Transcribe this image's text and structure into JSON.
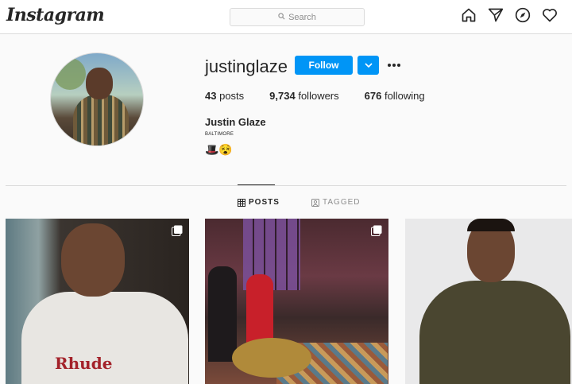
{
  "app": {
    "logo": "Instagram"
  },
  "search": {
    "placeholder": "Search"
  },
  "nav": {
    "icons": [
      "home-icon",
      "direct-icon",
      "explore-icon",
      "activity-heart-icon"
    ]
  },
  "profile": {
    "username": "justinglaze",
    "follow_label": "Follow",
    "posts_count": "43",
    "posts_label": "posts",
    "followers_count": "9,734",
    "followers_label": "followers",
    "following_count": "676",
    "following_label": "following",
    "full_name": "Justin Glaze",
    "bio_line": "BALTIMORE",
    "bio_emoji": "🎩😵"
  },
  "tabs": [
    {
      "label": "POSTS",
      "active": true
    },
    {
      "label": "TAGGED",
      "active": false
    }
  ],
  "posts": [
    {
      "multi": true,
      "shirt_text": "Rhude"
    },
    {
      "multi": true
    },
    {
      "multi": false
    }
  ],
  "colors": {
    "accent": "#0095f6",
    "border": "#dbdbdb",
    "muted": "#8e8e8e"
  }
}
